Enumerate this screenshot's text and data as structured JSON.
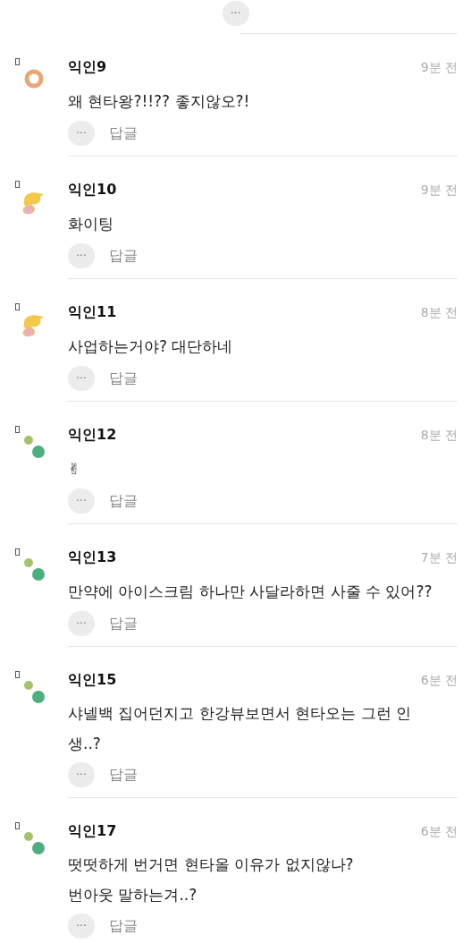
{
  "more_button": {
    "label": "···"
  },
  "comments": [
    {
      "author": "익인9",
      "time": "9분 전",
      "avatar": {
        "kind": "ring"
      },
      "lines": [
        "왜 현타왕?!!?? 좋지않오?!"
      ],
      "more": "···",
      "reply": "답글"
    },
    {
      "author": "익인10",
      "time": "9분 전",
      "avatar": {
        "kind": "blob"
      },
      "lines": [
        "화이팅"
      ],
      "more": "···",
      "reply": "답글"
    },
    {
      "author": "익인11",
      "time": "8분 전",
      "avatar": {
        "kind": "blob"
      },
      "lines": [
        "사업하는거야? 대단하네"
      ],
      "more": "···",
      "reply": "답글"
    },
    {
      "author": "익인12",
      "time": "8분 전",
      "avatar": {
        "kind": "dots"
      },
      "lines": [
        "✌"
      ],
      "more": "···",
      "reply": "답글"
    },
    {
      "author": "익인13",
      "time": "7분 전",
      "avatar": {
        "kind": "dots"
      },
      "lines": [
        "만약에 아이스크림 하나만 사달라하면 사줄 수 있어??"
      ],
      "more": "···",
      "reply": "답글"
    },
    {
      "author": "익인15",
      "time": "6분 전",
      "avatar": {
        "kind": "dots"
      },
      "lines": [
        "샤넬백 집어던지고 한강뷰보면서 현타오는 그런 인",
        "생..?"
      ],
      "more": "···",
      "reply": "답글"
    },
    {
      "author": "익인17",
      "time": "6분 전",
      "avatar": {
        "kind": "dots"
      },
      "lines": [
        "떳떳하게 번거면 현타올 이유가 없지않나?",
        "번아웃 말하는겨..?"
      ],
      "more": "···",
      "reply": "답글"
    }
  ]
}
